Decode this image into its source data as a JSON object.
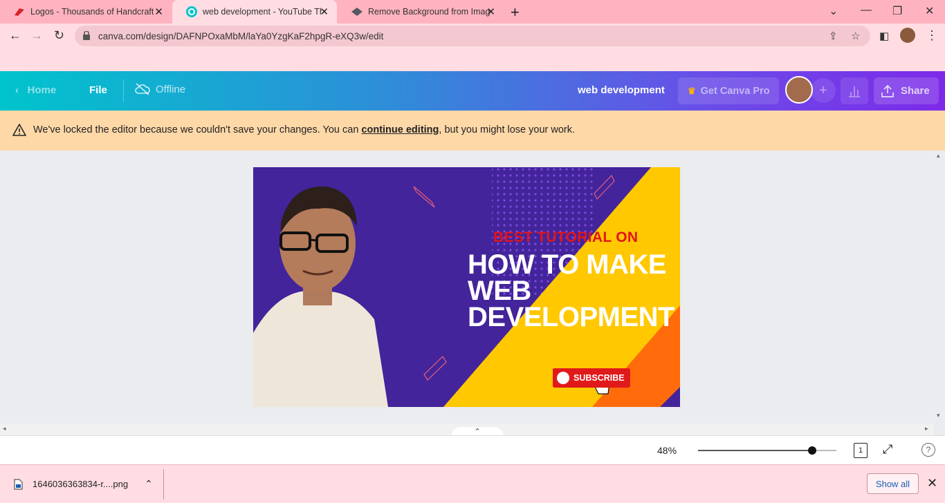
{
  "browser": {
    "tabs": [
      {
        "title": "Logos - Thousands of Handcrafted",
        "active": false
      },
      {
        "title": "web development - YouTube Thumbnail",
        "active": true
      },
      {
        "title": "Remove Background from Image",
        "active": false
      }
    ],
    "url": "canva.com/design/DAFNPOxaMbM/laYa0YzgKaF2hpgR-eXQ3w/edit"
  },
  "canva": {
    "home_label": "Home",
    "file_label": "File",
    "offline_label": "Offline",
    "design_title": "web development",
    "get_pro_label": "Get Canva Pro",
    "share_label": "Share"
  },
  "banner": {
    "message_before": "We've locked the editor because we couldn't save your changes. You can ",
    "link_text": "continue editing",
    "message_after": ", but you might lose your work."
  },
  "design": {
    "best_tutorial": "BEST TUTORIAL ON",
    "heading_line1": "HOW TO MAKE",
    "heading_line2": "WEB",
    "heading_line3": "DEVELOPMENT",
    "subscribe_label": "SUBSCRIBE"
  },
  "bottom": {
    "zoom": "48%",
    "zoom_fraction": 0.48,
    "page_count": "1"
  },
  "downloads": {
    "file_name": "1646036363834-r....png",
    "show_all_label": "Show all"
  },
  "colors": {
    "design_background": "#43249a",
    "design_yellow": "#ffc800",
    "design_orange": "#ff6b0a",
    "subscribe_red": "#e01a1a",
    "banner_warning": "#ffd8a8"
  }
}
